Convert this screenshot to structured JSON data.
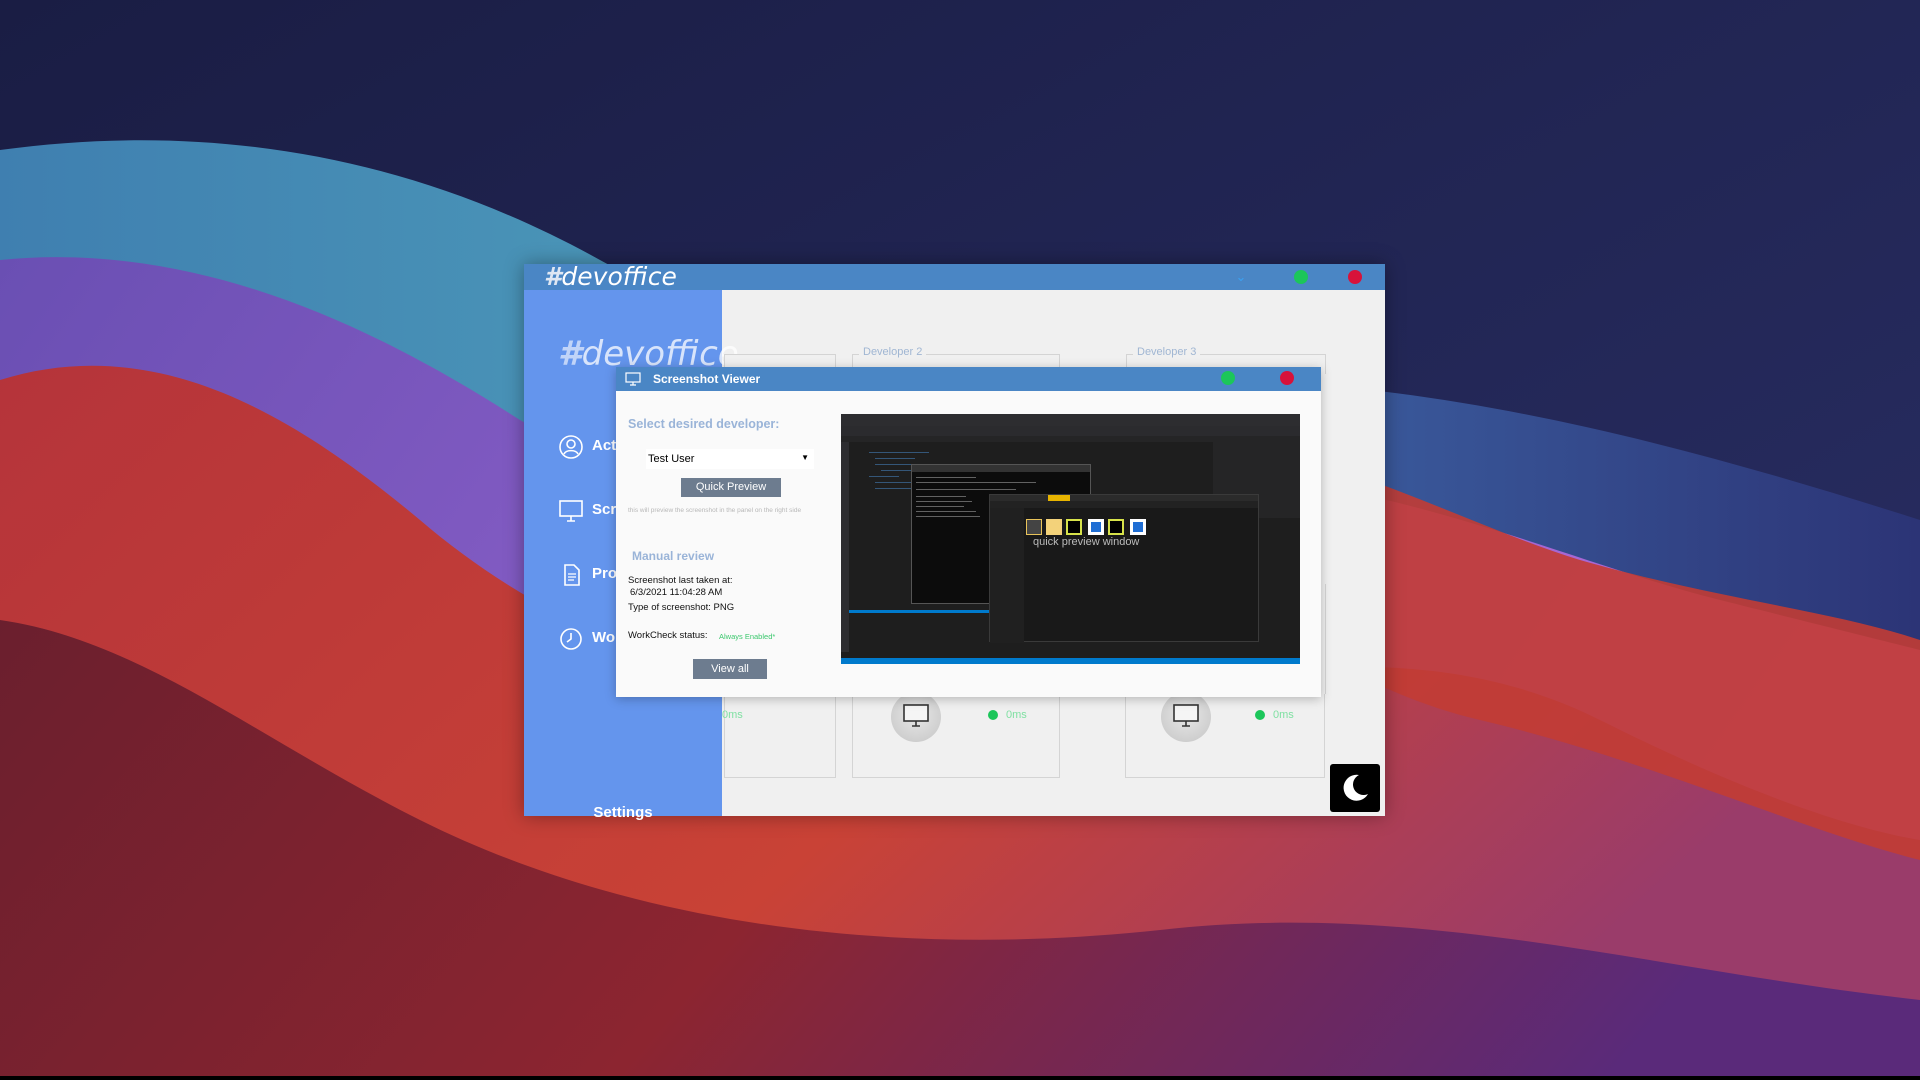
{
  "app": {
    "title_hash": "#",
    "title_text": "devoffice",
    "min_glyph": "⌄"
  },
  "sidebar": {
    "logo_hash": "#",
    "logo_text": "devoffice",
    "items": [
      {
        "label": "Act",
        "icon": "user-circle-icon"
      },
      {
        "label": "Scr",
        "icon": "monitor-icon"
      },
      {
        "label": "Pro",
        "icon": "document-icon"
      },
      {
        "label": "Wo",
        "icon": "clock-icon"
      }
    ],
    "settings_label": "Settings"
  },
  "developers": {
    "panels": [
      "Developer 2",
      "Developer 3"
    ],
    "pings": [
      "0ms",
      "0ms",
      "0ms"
    ]
  },
  "viewer": {
    "title": "Screenshot Viewer",
    "select_label": "Select desired developer:",
    "selected_developer": "Test User",
    "quick_preview_label": "Quick Preview",
    "hint": "this will preview the screenshot in the panel on the right side",
    "manual_review_label": "Manual review",
    "last_taken_label": "Screenshot last taken at:",
    "last_taken_value": "6/3/2021 11:04:28 AM",
    "type_text": "Type of screenshot: PNG",
    "workcheck_label": "WorkCheck status:",
    "workcheck_value": "Always Enabled*",
    "view_all_label": "View all",
    "preview_caption": "quick preview window"
  },
  "colors": {
    "titlebar": "#4a86c5",
    "sidebar": "#6495ed",
    "status_green": "#1cc65a",
    "close_red": "#d8123a",
    "button_gray": "#6d7c8f"
  }
}
